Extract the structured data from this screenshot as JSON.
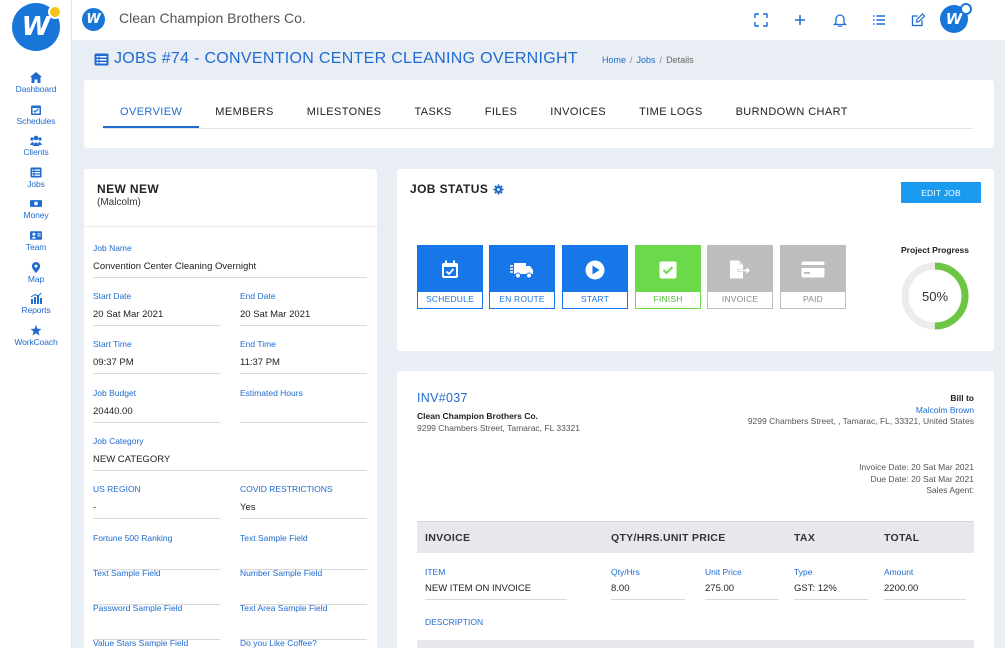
{
  "app": {
    "company": "Clean Champion Brothers Co.",
    "logo_icon": "w-logo-icon"
  },
  "sidebar": {
    "items": [
      {
        "label": "Dashboard",
        "icon": "home-icon"
      },
      {
        "label": "Schedules",
        "icon": "calendar-icon"
      },
      {
        "label": "Clients",
        "icon": "clients-icon"
      },
      {
        "label": "Jobs",
        "icon": "list-icon"
      },
      {
        "label": "Money",
        "icon": "money-icon"
      },
      {
        "label": "Team",
        "icon": "team-icon"
      },
      {
        "label": "Map",
        "icon": "map-pin-icon"
      },
      {
        "label": "Reports",
        "icon": "chart-icon"
      },
      {
        "label": "WorkCoach",
        "icon": "star-icon"
      }
    ]
  },
  "header": {
    "icons": [
      "fullscreen-icon",
      "plus-icon",
      "bell-icon",
      "menu-list-icon",
      "edit-icon",
      "avatar"
    ]
  },
  "page": {
    "title": "JOBS #74 - CONVENTION CENTER CLEANING OVERNIGHT",
    "breadcrumbs": [
      "Home",
      "Jobs",
      "Details"
    ]
  },
  "tabs": [
    "OVERVIEW",
    "MEMBERS",
    "MILESTONES",
    "TASKS",
    "FILES",
    "INVOICES",
    "TIME LOGS",
    "BURNDOWN CHART"
  ],
  "details": {
    "name": "NEW NEW",
    "subtitle": "(Malcolm)",
    "job_name_label": "Job Name",
    "job_name": "Convention Center Cleaning Overnight",
    "start_date_label": "Start Date",
    "start_date": "20 Sat Mar 2021",
    "end_date_label": "End Date",
    "end_date": "20 Sat Mar 2021",
    "start_time_label": "Start Time",
    "start_time": "09:37 PM",
    "end_time_label": "End Time",
    "end_time": "11:37 PM",
    "budget_label": "Job Budget",
    "budget": "20440.00",
    "hours_label": "Estimated Hours",
    "hours": "",
    "category_label": "Job Category",
    "category": "NEW CATEGORY",
    "region_label": "US REGION",
    "region": "-",
    "covid_label": "COVID RESTRICTIONS",
    "covid": "Yes",
    "fortune_label": "Fortune 500 Ranking",
    "text_sample_label": "Text Sample Field",
    "text_sample2_label": "Text Sample Field",
    "number_sample_label": "Number Sample Field",
    "password_sample_label": "Password Sample Field",
    "textarea_sample_label": "Text Area Sample Field",
    "stars_sample_label": "Value Stars Sample Field",
    "coffee_label": "Do you Like Coffee?"
  },
  "job_status": {
    "title": "JOB STATUS",
    "edit_label": "EDIT JOB",
    "stages": [
      {
        "label": "SCHEDULE",
        "icon": "calendar-check-icon"
      },
      {
        "label": "EN ROUTE",
        "icon": "truck-icon"
      },
      {
        "label": "START",
        "icon": "play-icon"
      },
      {
        "label": "FINISH",
        "icon": "checkbox-icon"
      },
      {
        "label": "INVOICE",
        "icon": "invoice-export-icon"
      },
      {
        "label": "PAID",
        "icon": "credit-card-icon"
      }
    ],
    "progress_title": "Project Progress",
    "progress_value": 50,
    "progress_label": "50%"
  },
  "invoice": {
    "number": "INV#037",
    "company": "Clean Champion Brothers Co.",
    "address": "9299 Chambers Street, Tamarac, FL 33321",
    "bill_to_label": "Bill to",
    "bill_to_name": "Malcolm Brown",
    "bill_to_address": "9299 Chambers Street, , Tamarac, FL, 33321, United States",
    "invoice_date_label": "Invoice Date:",
    "invoice_date": "20 Sat Mar 2021",
    "due_date_label": "Due Date:",
    "due_date": "20 Sat Mar 2021",
    "sales_agent_label": "Sales Agent:",
    "columns": [
      "INVOICE",
      "QTY/HRS.UNIT PRICE",
      "TAX",
      "TOTAL"
    ],
    "item_label": "ITEM",
    "item": "NEW ITEM ON INVOICE",
    "qty_label": "Qty/Hrs",
    "qty": "8.00",
    "price_label": "Unit Price",
    "price": "275.00",
    "type_label": "Type",
    "type": "GST: 12%",
    "amount_label": "Amount",
    "amount": "2200.00",
    "description_label": "DESCRIPTION"
  },
  "colors": {
    "primary": "#1776e8",
    "accent_button": "#1b9bf0",
    "finish": "#6bd94a",
    "disabled": "#bdbdbd",
    "progress": "#6cc644"
  }
}
